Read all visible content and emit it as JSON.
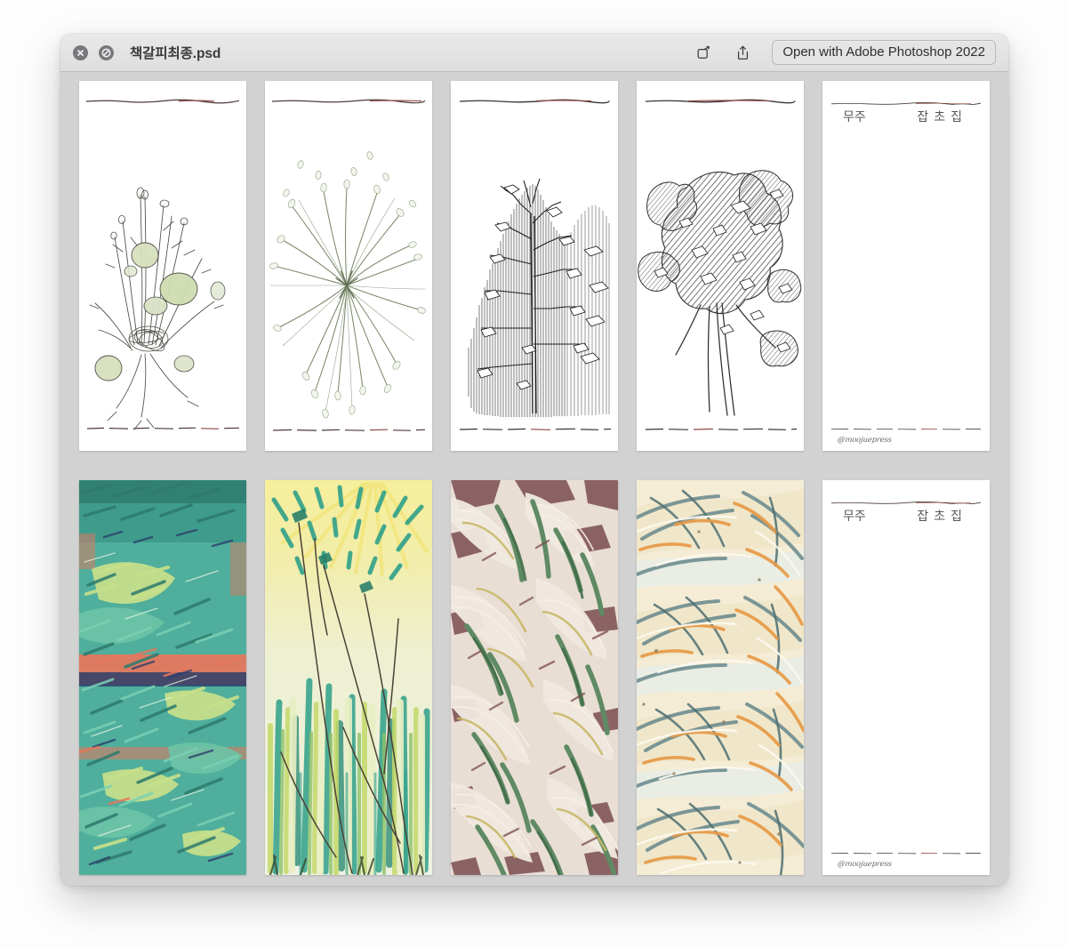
{
  "window": {
    "app": "quick-look",
    "titlebar": {
      "close_label": "Close",
      "no_entry_label": "No Entry",
      "title": "책갈피최종.psd",
      "fullscreen_label": "Open in full screen",
      "share_label": "Share",
      "open_with_label": "Open with Adobe Photoshop 2022"
    },
    "chrome": {
      "titlebar_bg": "#e4e4e3",
      "content_bg": "#d2d2d2",
      "title_color": "#3b3b3b",
      "button_gray": "#78787c"
    }
  },
  "gallery": {
    "rows": [
      {
        "name": "line-drawings-row",
        "cards": [
          {
            "id": "card-1",
            "kind": "artwork",
            "art": "botanical-line-drawing-seedpods",
            "caption": "",
            "ink_color": "#4e4c46",
            "accent_color": "#b9c79a",
            "has_rules": true
          },
          {
            "id": "card-2",
            "kind": "artwork",
            "art": "grass-tuft-line-drawing",
            "caption": "",
            "ink_color": "#6a7360",
            "accent_color": "#8a9a78",
            "has_rules": true
          },
          {
            "id": "card-3",
            "kind": "artwork",
            "art": "vertical-hatch-conifer-drawing",
            "caption": "",
            "ink_color": "#2e2e2e",
            "accent_color": "#444444",
            "has_rules": true
          },
          {
            "id": "card-4",
            "kind": "artwork",
            "art": "diagonal-hatch-shrub-drawing",
            "caption": "",
            "ink_color": "#3a3a3a",
            "accent_color": "#565656",
            "has_rules": true
          },
          {
            "id": "card-5",
            "kind": "cover",
            "art": "blank-cover-with-handwriting",
            "title_left": "무주",
            "title_right": "잡초집",
            "signature": "@moojuepress",
            "has_rules": true
          }
        ]
      },
      {
        "name": "color-pastel-row",
        "cards": [
          {
            "id": "card-6",
            "kind": "artwork",
            "art": "teal-green-pastel-foliage",
            "palette": [
              "#4fae9c",
              "#6cc4a6",
              "#c7e08a",
              "#2e7a6d",
              "#e8765c",
              "#2c3f6b"
            ]
          },
          {
            "id": "card-7",
            "kind": "artwork",
            "art": "yellow-green-sunburst-grass",
            "palette": [
              "#f3ec96",
              "#cfe07e",
              "#2fa089",
              "#8dc26a",
              "#efe9c4",
              "#4a4036"
            ]
          },
          {
            "id": "card-8",
            "kind": "artwork",
            "art": "pink-cream-pampas-grass",
            "palette": [
              "#e8dcd2",
              "#cdb4ad",
              "#7b4d4f",
              "#5f8a63",
              "#c9b96a",
              "#f2ece4"
            ]
          },
          {
            "id": "card-9",
            "kind": "artwork",
            "art": "cream-slate-orange-reeds",
            "palette": [
              "#f3ead0",
              "#e8e2cf",
              "#6f8d90",
              "#e79a47",
              "#cfd9d4",
              "#a8b9b4"
            ]
          },
          {
            "id": "card-10",
            "kind": "cover",
            "art": "blank-cover-with-handwriting",
            "title_left": "무주",
            "title_right": "잡초집",
            "signature": "@moojuepress",
            "has_rules": true
          }
        ]
      }
    ]
  }
}
